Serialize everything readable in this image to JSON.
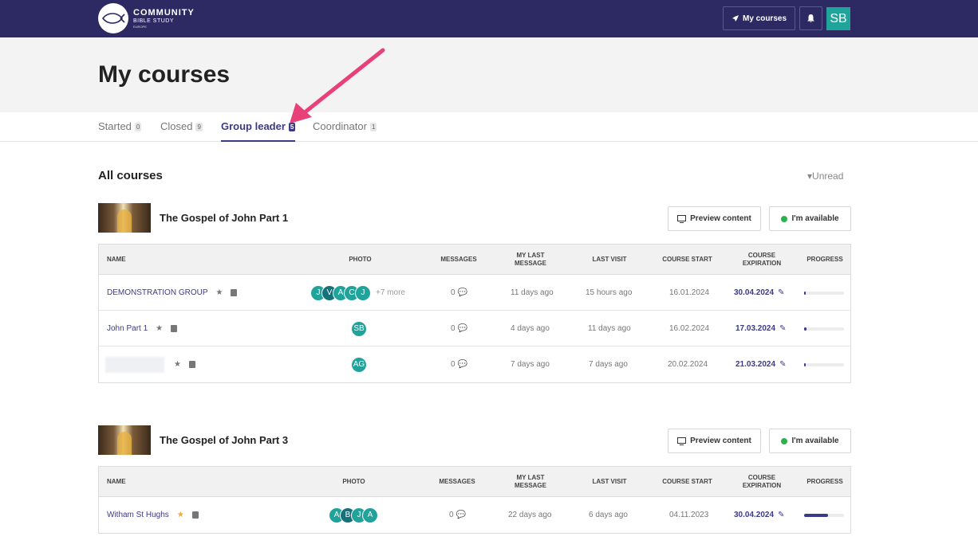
{
  "brand": {
    "line1": "COMMUNITY",
    "line2": "BIBLE STUDY",
    "line3": "EUROPE"
  },
  "topnav": {
    "my_courses": "My courses",
    "avatar": "SB",
    "accent": "#2d2a63"
  },
  "page_title": "My courses",
  "tabs": [
    {
      "label": "Started",
      "count": "0"
    },
    {
      "label": "Closed",
      "count": "9"
    },
    {
      "label": "Group leader",
      "count": "5",
      "active": true
    },
    {
      "label": "Coordinator",
      "count": "1"
    }
  ],
  "section_title": "All courses",
  "filter_label": "Unread",
  "buttons": {
    "preview": "Preview content",
    "available": "I'm available"
  },
  "headers": {
    "name": "NAME",
    "photo": "PHOTO",
    "messages": "MESSAGES",
    "my_last_message": "MY LAST MESSAGE",
    "last_visit": "LAST VISIT",
    "course_start": "COURSE START",
    "course_expiration": "COURSE EXPIRATION",
    "progress": "PROGRESS"
  },
  "courses": [
    {
      "title": "The Gospel of John Part 1",
      "rows": [
        {
          "name": "DEMONSTRATION GROUP",
          "avatars": [
            "J",
            "V",
            "A",
            "C",
            "J"
          ],
          "more": "+7 more",
          "messages": "0",
          "my_last": "11 days ago",
          "last_visit": "15 hours ago",
          "start": "16.01.2024",
          "expiration": "30.04.2024",
          "progress": 0.04
        },
        {
          "name": "John Part 1",
          "avatars": [
            "SB"
          ],
          "messages": "0",
          "my_last": "4 days ago",
          "last_visit": "11 days ago",
          "start": "16.02.2024",
          "expiration": "17.03.2024",
          "progress": 0.06
        },
        {
          "name": "",
          "avatars": [
            "AG"
          ],
          "messages": "0",
          "my_last": "7 days ago",
          "last_visit": "7 days ago",
          "start": "20.02.2024",
          "expiration": "21.03.2024",
          "progress": 0.03
        }
      ]
    },
    {
      "title": "The Gospel of John Part 3",
      "rows": [
        {
          "name": "Witham St Hughs",
          "avatars": [
            "A",
            "B",
            "J",
            "A"
          ],
          "messages": "0",
          "my_last": "22 days ago",
          "last_visit": "6 days ago",
          "start": "04.11.2023",
          "expiration": "30.04.2024",
          "progress": 0.6
        }
      ]
    }
  ]
}
